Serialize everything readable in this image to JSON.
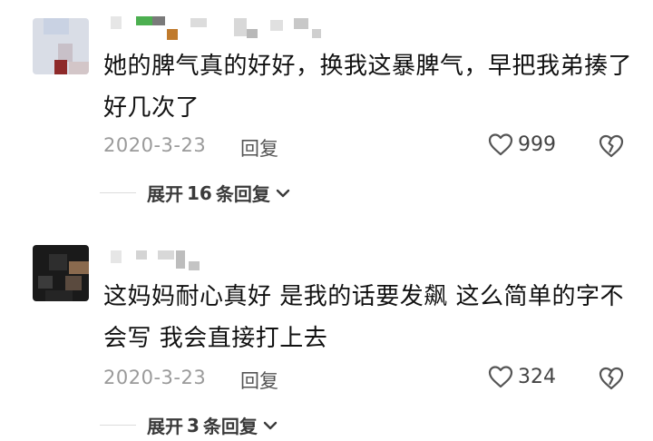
{
  "comments": [
    {
      "text": "她的脾气真的好好，换我这暴脾气，早把我弟揍了好几次了",
      "date": "2020-3-23",
      "reply_label": "回复",
      "likes": "999",
      "expand_label": "展开16条回复",
      "expand_prefix": "展开",
      "expand_count": "16",
      "expand_suffix": "条回复"
    },
    {
      "text": "这妈妈耐心真好 是我的话要发飙 这么简单的字不会写 我会直接打上去",
      "date": "2020-3-23",
      "reply_label": "回复",
      "likes": "324",
      "expand_label": "展开3条回复",
      "expand_prefix": "展开",
      "expand_count": "3",
      "expand_suffix": "条回复"
    }
  ],
  "colors": {
    "text": "#111111",
    "meta": "#9a9a9a",
    "accent_orange": "#c07a2c",
    "accent_green": "#4caf50"
  },
  "icons": {
    "like": "heart-outline-icon",
    "dislike": "broken-heart-icon",
    "expand": "chevron-down-icon"
  }
}
